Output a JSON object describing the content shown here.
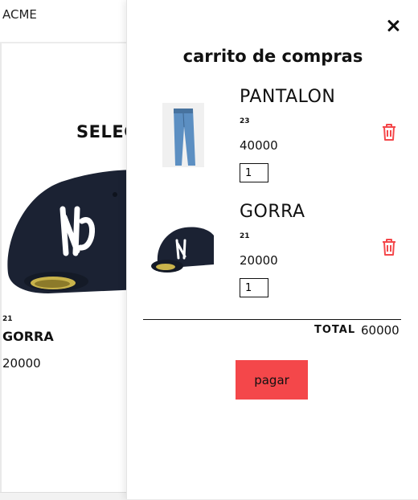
{
  "background": {
    "brand": "ACME",
    "section_title": "SELEC",
    "product": {
      "meta": "21",
      "name": "GORRA",
      "price": "20000"
    }
  },
  "cart": {
    "title": "carrito de compras",
    "close_icon": "close-icon",
    "items": [
      {
        "name": "PANTALON",
        "meta": "23",
        "price": "40000",
        "quantity": "1",
        "thumb_icon": "jeans-icon",
        "delete_icon": "trash-icon"
      },
      {
        "name": "GORRA",
        "meta": "21",
        "price": "20000",
        "quantity": "1",
        "thumb_icon": "cap-icon",
        "delete_icon": "trash-icon"
      }
    ],
    "total_label": "TOTAL",
    "total_value": "60000",
    "pay_label": "pagar"
  },
  "colors": {
    "accent": "#f4474a",
    "text": "#111111"
  }
}
